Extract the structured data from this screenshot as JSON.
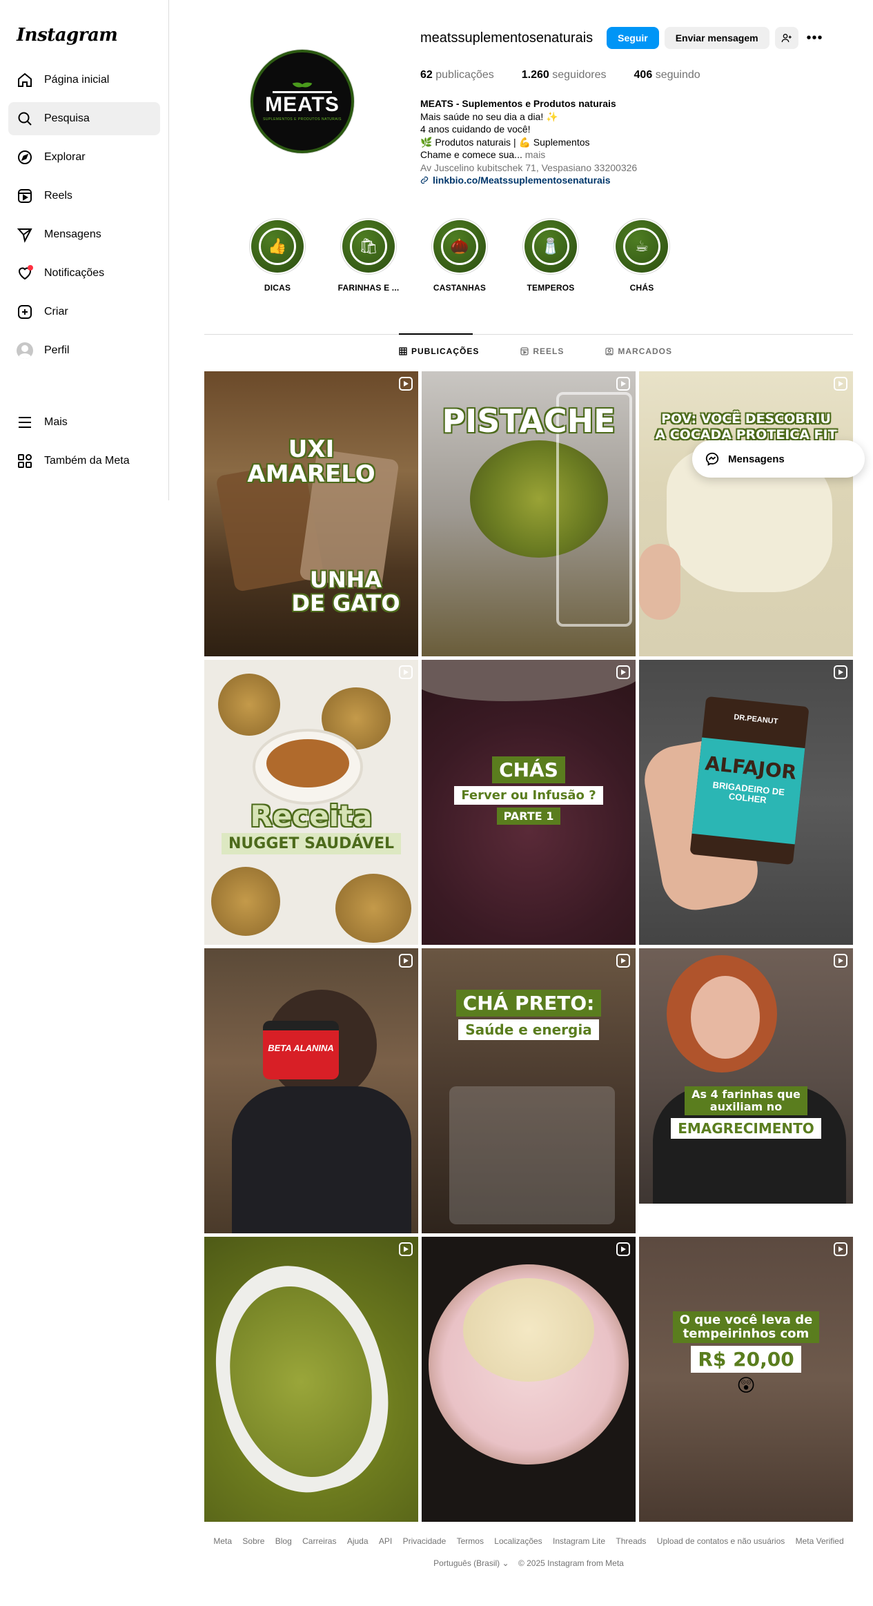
{
  "app": {
    "logo": "Instagram"
  },
  "sidebar": {
    "items": [
      {
        "label": "Página inicial",
        "icon": "home-icon"
      },
      {
        "label": "Pesquisa",
        "icon": "search-icon"
      },
      {
        "label": "Explorar",
        "icon": "compass-icon"
      },
      {
        "label": "Reels",
        "icon": "reels-icon"
      },
      {
        "label": "Mensagens",
        "icon": "paper-plane-icon"
      },
      {
        "label": "Notificações",
        "icon": "heart-icon"
      },
      {
        "label": "Criar",
        "icon": "plus-square-icon"
      },
      {
        "label": "Perfil",
        "icon": "avatar"
      }
    ],
    "more": {
      "label": "Mais",
      "icon": "menu-icon"
    },
    "meta": {
      "label": "Também da Meta",
      "icon": "meta-apps-icon"
    }
  },
  "profile": {
    "avatar_text": "MEATS",
    "avatar_subtext": "SUPLEMENTOS E PRODUTOS NATURAIS",
    "username": "meatssuplementosenaturais",
    "follow_label": "Seguir",
    "message_label": "Enviar mensagem",
    "more_label": "•••",
    "stats": {
      "posts_count": "62",
      "posts_label": "publicações",
      "followers_count": "1.260",
      "followers_label": "seguidores",
      "following_count": "406",
      "following_label": "seguindo"
    },
    "bio": {
      "name": "MEATS - Suplementos e Produtos naturais",
      "line1": "Mais saúde no seu dia a dia! ✨",
      "line2": "4 anos cuidando de você!",
      "line3": "🌿 Produtos naturais | 💪 Suplementos",
      "line4": "Chame e comece sua...",
      "more": "mais",
      "address": "Av Juscelino kubitschek 71, Vespasiano 33200326",
      "link": "linkbio.co/Meatssuplementosenaturais"
    }
  },
  "highlights": [
    {
      "label": "DICAS",
      "glyph": "👍"
    },
    {
      "label": "FARINHAS E ...",
      "glyph": "🛍"
    },
    {
      "label": "CASTANHAS",
      "glyph": "🌰"
    },
    {
      "label": "TEMPEROS",
      "glyph": "🧂"
    },
    {
      "label": "CHÁS",
      "glyph": "☕"
    }
  ],
  "tabs": [
    {
      "label": "PUBLICAÇÕES",
      "icon": "grid-icon",
      "active": true
    },
    {
      "label": "REELS",
      "icon": "reels-icon",
      "active": false
    },
    {
      "label": "MARCADOS",
      "icon": "tagged-icon",
      "active": false
    }
  ],
  "posts": {
    "p1": {
      "line1": "UXI",
      "line2": "AMARELO",
      "line3": "UNHA",
      "line4": "DE GATO"
    },
    "p2": {
      "title": "PISTACHE"
    },
    "p3": {
      "line1": "POV: VOCÊ DESCOBRIU",
      "line2": "A COCADA PROTEICA FIT"
    },
    "p4": {
      "title": "Receita",
      "subtitle": "NUGGET SAUDÁVEL"
    },
    "p5": {
      "title": "CHÁS",
      "subtitle": "Ferver ou Infusão ?",
      "tag": "PARTE 1"
    },
    "p6": {
      "brand": "DR.PEANUT",
      "product": "ALFAJOR",
      "flavor": "BRIGADEIRO DE COLHER"
    },
    "p7": {
      "product": "BETA ALANINA"
    },
    "p8": {
      "title": "CHÁ PRETO:",
      "subtitle": "Saúde e energia"
    },
    "p9": {
      "line1": "As 4 farinhas que",
      "line2": "auxiliam no",
      "line3": "EMAGRECIMENTO"
    },
    "p12": {
      "line1": "O que você leva de",
      "line2": "tempeirinhos com",
      "price": "R$ 20,00",
      "emoji": "😲"
    }
  },
  "floating_messages": {
    "label": "Mensagens"
  },
  "footer": {
    "links": [
      "Meta",
      "Sobre",
      "Blog",
      "Carreiras",
      "Ajuda",
      "API",
      "Privacidade",
      "Termos",
      "Localizações",
      "Instagram Lite",
      "Threads",
      "Upload de contatos e não usuários",
      "Meta Verified"
    ],
    "language": "Português (Brasil)",
    "copyright": "© 2025 Instagram from Meta"
  },
  "colors": {
    "accent": "#0095f6",
    "brand_green": "#5a7d1e",
    "link": "#00376b"
  }
}
